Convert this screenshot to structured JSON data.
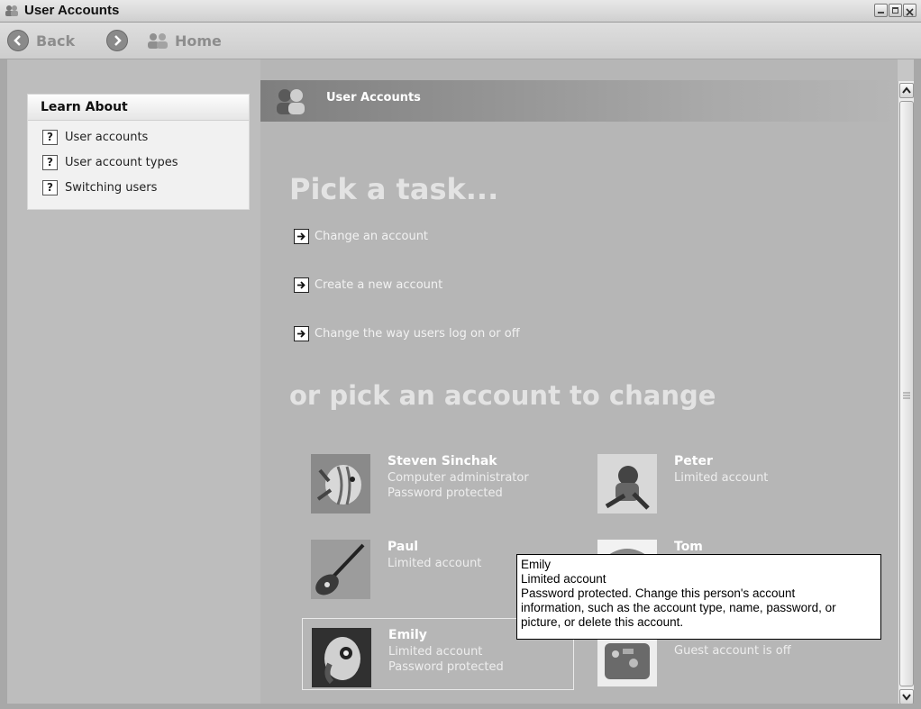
{
  "window": {
    "title": "User Accounts"
  },
  "toolbar": {
    "back_label": "Back",
    "home_label": "Home"
  },
  "learn_about": {
    "heading": "Learn About",
    "items": [
      {
        "label": "User accounts"
      },
      {
        "label": "User account types"
      },
      {
        "label": "Switching users"
      }
    ]
  },
  "main": {
    "header_title": "User Accounts",
    "pick_task": "Pick a task...",
    "tasks": [
      {
        "label": "Change an account"
      },
      {
        "label": "Create a new account"
      },
      {
        "label": "Change the way users log on or off"
      }
    ],
    "pick_account": "or pick an account to change"
  },
  "accounts": [
    {
      "name": "Steven Sinchak",
      "line1": "Computer administrator",
      "line2": "Password protected"
    },
    {
      "name": "Peter",
      "line1": "Limited account",
      "line2": ""
    },
    {
      "name": "Paul",
      "line1": "Limited account",
      "line2": ""
    },
    {
      "name": "Tom",
      "line1": "",
      "line2": ""
    },
    {
      "name": "Emily",
      "line1": "Limited account",
      "line2": "Password protected"
    },
    {
      "name": "",
      "line1": "Guest account is off",
      "line2": ""
    }
  ],
  "tooltip": {
    "lines": [
      "Emily",
      "Limited account",
      "Password protected. Change this person's account",
      "information, such as the account type, name, password, or",
      "picture, or delete this account."
    ]
  }
}
